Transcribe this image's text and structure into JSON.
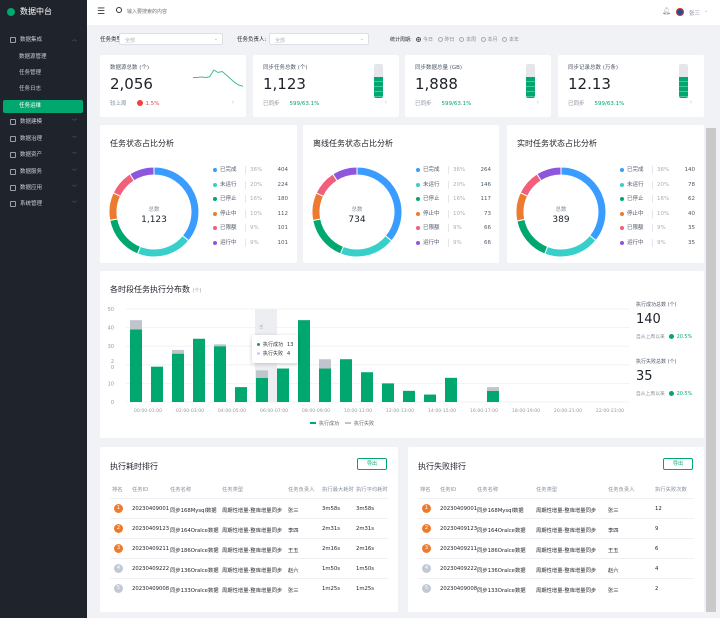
{
  "app": {
    "title": "数据中台"
  },
  "sidebar": {
    "items": [
      {
        "label": "数据集成",
        "type": "group",
        "expanded": true
      },
      {
        "label": "数据源管理",
        "type": "sub"
      },
      {
        "label": "任务管理",
        "type": "sub"
      },
      {
        "label": "任务日志",
        "type": "sub"
      },
      {
        "label": "任务运维",
        "type": "sub",
        "active": true
      },
      {
        "label": "数据建模",
        "type": "group"
      },
      {
        "label": "数据治理",
        "type": "group"
      },
      {
        "label": "数据资产",
        "type": "group"
      },
      {
        "label": "数据服务",
        "type": "group"
      },
      {
        "label": "数据应用",
        "type": "group"
      },
      {
        "label": "系统管理",
        "type": "group"
      }
    ]
  },
  "header": {
    "search_placeholder": "输入要搜索的内容",
    "user": "张三"
  },
  "filters": {
    "task_type_label": "任务类型:",
    "task_type_value": "全部",
    "owner_label": "任务负责人:",
    "owner_value": "全部",
    "period_label": "统计周期:",
    "periods": [
      "今日",
      "昨日",
      "本周",
      "本月",
      "本年"
    ],
    "selected_period": "今日"
  },
  "kpis": [
    {
      "label": "数据源总数 (个)",
      "value": "2,056",
      "foot_label": "较上周",
      "foot_value": "1.5%",
      "trend": "down",
      "sparkline": [
        5,
        5,
        5.2,
        5,
        5.3,
        8,
        7,
        7.4,
        6,
        4.5,
        3,
        2,
        1.5
      ]
    },
    {
      "label": "同步任务总数 (个)",
      "value": "1,123",
      "foot_label": "已同步",
      "foot_value": "599/63.1%",
      "fill_percent": 63.1
    },
    {
      "label": "同步数据总量 (GB)",
      "value": "1,888",
      "foot_label": "已同步",
      "foot_value": "599/63.1%",
      "fill_percent": 63.1
    },
    {
      "label": "同步记录总数 (万条)",
      "value": "12.13",
      "foot_label": "已同步",
      "foot_value": "599/63.1%",
      "fill_percent": 63.1
    }
  ],
  "colors": {
    "accent": "#00a76f",
    "status": [
      "#3a9cff",
      "#36cfc9",
      "#00a76f",
      "#ed7b2f",
      "#f25f7a",
      "#8e56dd"
    ],
    "fail": "#bfc4cd"
  },
  "donuts": [
    {
      "title": "任务状态占比分析",
      "center_label": "总数",
      "total": "1,123",
      "items": [
        {
          "name": "已完成",
          "pct": "36%",
          "value": 404
        },
        {
          "name": "未运行",
          "pct": "20%",
          "value": 224
        },
        {
          "name": "已停止",
          "pct": "16%",
          "value": 180
        },
        {
          "name": "停止中",
          "pct": "10%",
          "value": 112
        },
        {
          "name": "已限额",
          "pct": "9%",
          "value": 101
        },
        {
          "name": "运行中",
          "pct": "9%",
          "value": 101
        }
      ]
    },
    {
      "title": "离线任务状态占比分析",
      "center_label": "总数",
      "total": "734",
      "items": [
        {
          "name": "已完成",
          "pct": "36%",
          "value": 264
        },
        {
          "name": "未运行",
          "pct": "20%",
          "value": 146
        },
        {
          "name": "已停止",
          "pct": "16%",
          "value": 117
        },
        {
          "name": "停止中",
          "pct": "10%",
          "value": 73
        },
        {
          "name": "已限额",
          "pct": "9%",
          "value": 66
        },
        {
          "name": "运行中",
          "pct": "9%",
          "value": 66
        }
      ]
    },
    {
      "title": "实时任务状态占比分析",
      "center_label": "总数",
      "total": "389",
      "items": [
        {
          "name": "已完成",
          "pct": "36%",
          "value": 140
        },
        {
          "name": "未运行",
          "pct": "20%",
          "value": 78
        },
        {
          "name": "已停止",
          "pct": "16%",
          "value": 62
        },
        {
          "name": "停止中",
          "pct": "10%",
          "value": 40
        },
        {
          "name": "已限额",
          "pct": "9%",
          "value": 35
        },
        {
          "name": "运行中",
          "pct": "9%",
          "value": 35
        }
      ]
    }
  ],
  "chart_data": {
    "type": "bar",
    "stacked": true,
    "title": "各时段任务执行分布数",
    "title_unit": "(个)",
    "categories": [
      "00:00-01:00",
      "01:00-02:00",
      "02:00-03:00",
      "03:00-04:00",
      "04:00-05:00",
      "05:00-06:00",
      "06:00-07:00",
      "07:00-08:00",
      "08:00-09:00",
      "09:00-10:00",
      "10:00-11:00",
      "11:00-12:00",
      "12:00-13:00",
      "13:00-14:00",
      "14:00-15:00",
      "15:00-16:00",
      "16:00-17:00",
      "17:00-18:00",
      "18:00-19:00",
      "19:00-20:00",
      "20:00-21:00",
      "21:00-22:00",
      "22:00-23:00",
      "23:00-24:00"
    ],
    "series": [
      {
        "name": "执行成功",
        "values": [
          39,
          19,
          26,
          34,
          30,
          8,
          13,
          18,
          44,
          18,
          23,
          16,
          10,
          6,
          4,
          13,
          0,
          6,
          0,
          0,
          0,
          0,
          0,
          0
        ]
      },
      {
        "name": "执行失败",
        "values": [
          5,
          0,
          2,
          0,
          1,
          0,
          4,
          0,
          0,
          5,
          0,
          0,
          0,
          0,
          0,
          0,
          0,
          2,
          0,
          0,
          0,
          0,
          0,
          0
        ]
      }
    ],
    "yticks": [
      "0",
      "10",
      "2\n0",
      "30",
      "40",
      "50"
    ],
    "ylim": [
      0,
      50
    ],
    "grid": true,
    "legend": "bottom",
    "tooltip": {
      "category_index": 6,
      "items": [
        {
          "name": "执行成功",
          "value": "13"
        },
        {
          "name": "执行失败",
          "value": "4"
        }
      ]
    }
  },
  "exec_stats": [
    {
      "label": "执行成功总数 (个)",
      "value": "140",
      "foot_label": "自从上周以来",
      "foot_value": "20.5%"
    },
    {
      "label": "执行失败总数 (个)",
      "value": "35",
      "foot_label": "自从上周以来",
      "foot_value": "20.5%"
    }
  ],
  "tables": [
    {
      "title": "执行耗时排行",
      "export_label": "导出",
      "columns": [
        "排名",
        "任务ID",
        "任务名称",
        "任务类型",
        "任务负责人",
        "执行最大耗时",
        "执行平均耗时"
      ],
      "rows": [
        [
          "1",
          "20230409001",
          "同步168Mysql数据",
          "周期性增量-整库增量同步",
          "张三",
          "3m58s",
          "3m58s"
        ],
        [
          "2",
          "20230409123",
          "同步164Oralce数据",
          "周期性增量-整库增量同步",
          "李四",
          "2m31s",
          "2m31s"
        ],
        [
          "3",
          "20230409211",
          "同步186Oralce数据",
          "周期性增量-整库增量同步",
          "王五",
          "2m16s",
          "2m16s"
        ],
        [
          "4",
          "20230409222",
          "同步136Oralce数据",
          "周期性增量-整库增量同步",
          "赵六",
          "1m50s",
          "1m50s"
        ],
        [
          "5",
          "20230409008",
          "同步133Oralce数据",
          "周期性增量-整库增量同步",
          "张三",
          "1m25s",
          "1m25s"
        ]
      ]
    },
    {
      "title": "执行失败排行",
      "export_label": "导出",
      "columns": [
        "排名",
        "任务ID",
        "任务名称",
        "任务类型",
        "任务负责人",
        "执行失败次数"
      ],
      "rows": [
        [
          "1",
          "20230409001",
          "同步168Mysql数据",
          "周期性增量-整库增量同步",
          "张三",
          "12"
        ],
        [
          "2",
          "20230409123",
          "同步164Oralce数据",
          "周期性增量-整库增量同步",
          "李四",
          "9"
        ],
        [
          "3",
          "20230409211",
          "同步186Oralce数据",
          "周期性增量-整库增量同步",
          "王五",
          "6"
        ],
        [
          "4",
          "20230409222",
          "同步136Oralce数据",
          "周期性增量-整库增量同步",
          "赵六",
          "4"
        ],
        [
          "5",
          "20230409008",
          "同步133Oralce数据",
          "周期性增量-整库增量同步",
          "张三",
          "2"
        ]
      ]
    }
  ]
}
